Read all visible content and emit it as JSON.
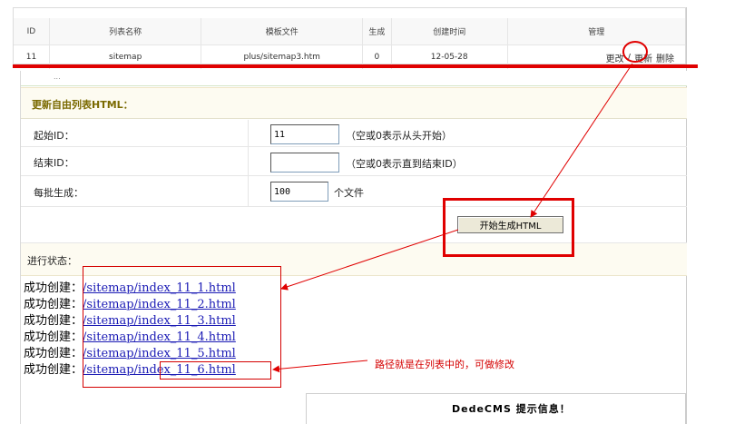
{
  "top_table": {
    "headers": [
      "ID",
      "列表名称",
      "模板文件",
      "生成",
      "创建时间",
      "管理"
    ],
    "row": {
      "id": "11",
      "name": "sitemap",
      "template": "plus/sitemap3.htm",
      "generated": "0",
      "created": "12-05-28"
    },
    "ops": {
      "edit": "更改",
      "sep": "/",
      "update": "更新",
      "delete": "删除"
    }
  },
  "panel": {
    "dash": "...",
    "title": "更新自由列表HTML：",
    "start_id": {
      "label": "起始ID：",
      "value": "11",
      "hint": "（空或0表示从头开始）"
    },
    "end_id": {
      "label": "结束ID：",
      "value": "",
      "hint": "（空或0表示直到结束ID）"
    },
    "batch": {
      "label": "每批生成：",
      "value": "100",
      "unit": "个文件"
    },
    "start_button": "开始生成HTML",
    "status_label": "进行状态：",
    "results": [
      {
        "prefix": "成功创建：",
        "link": "/sitemap/index_11_1.html"
      },
      {
        "prefix": "成功创建：",
        "link": "/sitemap/index_11_2.html"
      },
      {
        "prefix": "成功创建：",
        "link": "/sitemap/index_11_3.html"
      },
      {
        "prefix": "成功创建：",
        "link": "/sitemap/index_11_4.html"
      },
      {
        "prefix": "成功创建：",
        "link": "/sitemap/index_11_5.html"
      },
      {
        "prefix": "成功创建：",
        "link": "/sitemap/index_11_6.html"
      }
    ],
    "info_box_title": "DedeCMS 提示信息！"
  },
  "annotation": {
    "note": "路径就是在列表中的，可做修改",
    "color": "#e00000"
  }
}
